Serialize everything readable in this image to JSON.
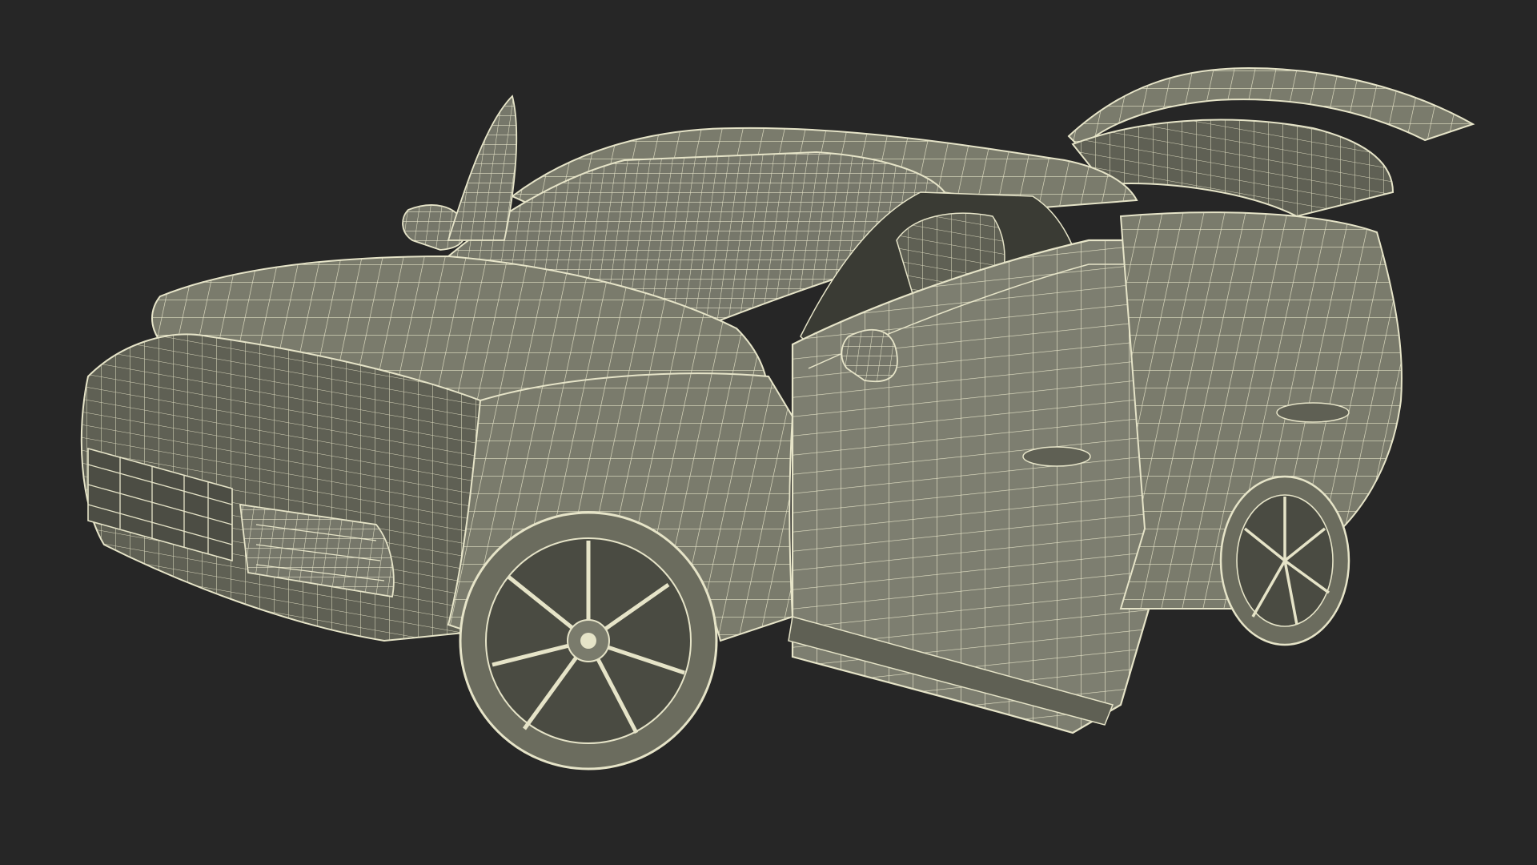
{
  "scene": {
    "subject": "suv-wireframe-model",
    "background_color": "#262626",
    "body_fill": "#7a7b6c",
    "body_fill_dark": "#5f6054",
    "wire_color": "#e6e4c8",
    "wheel_fill": "#6b6c5e",
    "interior_dark": "#3a3b34",
    "icons": [
      "car-body",
      "wheel",
      "door",
      "mirror",
      "hatch"
    ]
  }
}
